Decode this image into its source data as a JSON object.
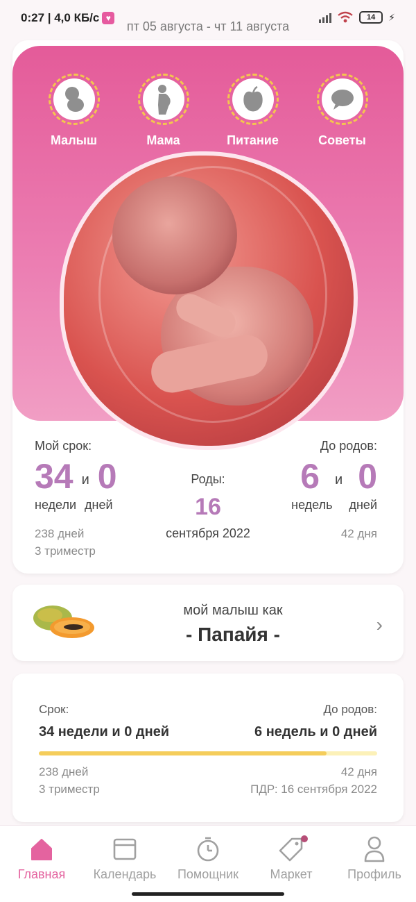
{
  "status_bar": {
    "time_speed": "0:27 | 4,0 КБ/с",
    "battery": "14"
  },
  "header": {
    "date_range": "пт 05 августа - чт 11 августа"
  },
  "categories": [
    {
      "label": "Малыш",
      "icon": "baby-icon"
    },
    {
      "label": "Мама",
      "icon": "pregnant-mother-icon"
    },
    {
      "label": "Питание",
      "icon": "apple-icon"
    },
    {
      "label": "Советы",
      "icon": "chat-bubble-icon"
    }
  ],
  "term": {
    "label": "Мой срок:",
    "weeks": "34",
    "conj": "и",
    "days": "0",
    "weeks_unit": "недели",
    "days_unit": "дней",
    "total_days": "238 дней",
    "trimester": "3 триместр"
  },
  "due": {
    "label": "Роды:",
    "day": "16",
    "month_year": "сентября 2022"
  },
  "until_birth": {
    "label": "До родов:",
    "weeks": "6",
    "conj": "и",
    "days": "0",
    "weeks_unit": "недель",
    "days_unit": "дней",
    "total_days": "42 дня"
  },
  "baby_size": {
    "subtitle": "мой малыш как",
    "title": "- Папайя -",
    "fruit_icon": "papaya-icon"
  },
  "progress": {
    "term_label": "Срок:",
    "term_value": "34 недели и 0 дней",
    "until_label": "До родов:",
    "until_value": "6 недель и 0 дней",
    "fraction": 0.85,
    "days": "238 дней",
    "trimester": "3 триместр",
    "remaining_days": "42 дня",
    "edd": "ПДР: 16 сентября 2022"
  },
  "bottom_nav": [
    {
      "label": "Главная",
      "icon": "home-icon",
      "active": true
    },
    {
      "label": "Календарь",
      "icon": "calendar-icon",
      "active": false
    },
    {
      "label": "Помощник",
      "icon": "timer-icon",
      "active": false
    },
    {
      "label": "Маркет",
      "icon": "tag-icon",
      "active": false
    },
    {
      "label": "Профиль",
      "icon": "profile-icon",
      "active": false
    }
  ],
  "colors": {
    "accent": "#e4639f",
    "number": "#b67ab8",
    "progress": "#f5cd5b"
  }
}
